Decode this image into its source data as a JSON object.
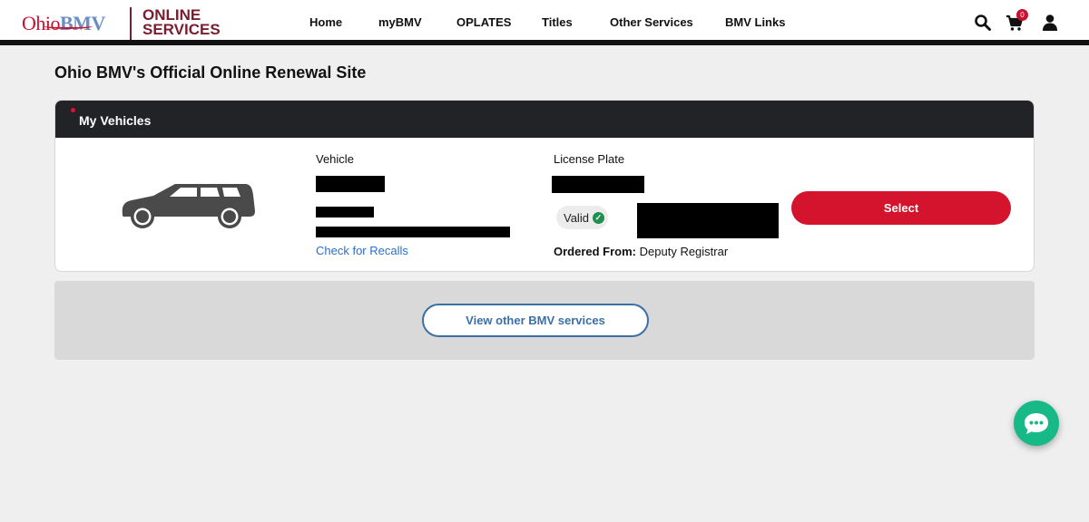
{
  "header": {
    "logo_ohio": "Ohio",
    "logo_bmv": "BMV",
    "logo_services_line1": "ONLINE",
    "logo_services_line2": "SERVICES",
    "nav": [
      {
        "label": "Home"
      },
      {
        "label": "myBMV"
      },
      {
        "label": "OPLATES"
      },
      {
        "label": "Titles"
      },
      {
        "label": "Other Services"
      },
      {
        "label": "BMV Links"
      }
    ],
    "icons": [
      "search-icon",
      "cart-icon",
      "user-icon"
    ],
    "cart_count": "0"
  },
  "page": {
    "title": "Ohio BMV's Official Online Renewal Site"
  },
  "vehicles": {
    "header": "My Vehicles",
    "vehicle_label": "Vehicle",
    "plate_label": "License Plate",
    "recall_link": "Check for Recalls",
    "status": "Valid",
    "ordered_from_label": "Ordered From:",
    "ordered_from_value": "Deputy Registrar",
    "select_button": "Select",
    "vehicle_icon": "station-wagon-icon"
  },
  "services": {
    "button": "View other BMV services"
  },
  "chat": {
    "icon": "chat-bubble-icon"
  },
  "colors": {
    "brand_red": "#d3142c",
    "brand_maroon": "#7a1d2e",
    "link_blue": "#2a6fcc",
    "chat_green": "#17b986",
    "valid_green": "#1f8f4e"
  }
}
